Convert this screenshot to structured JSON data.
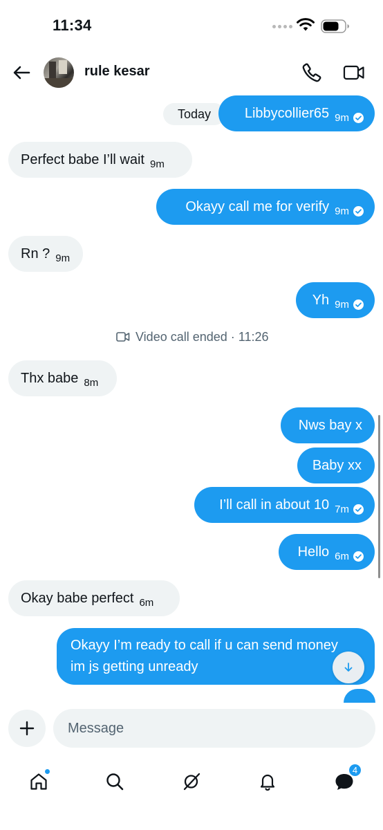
{
  "status_bar": {
    "time": "11:34"
  },
  "header": {
    "contact_name": "rule kesar"
  },
  "date_separator": "Today",
  "call_event": {
    "text": "Video call ended · 11:26"
  },
  "messages": [
    {
      "text": "Libbycollier65",
      "time": "9m",
      "direction": "out"
    },
    {
      "text": "Perfect babe I’ll wait",
      "time": "9m",
      "direction": "in"
    },
    {
      "text": "Okayy call me for verify",
      "time": "9m",
      "direction": "out"
    },
    {
      "text": "Rn ?",
      "time": "9m",
      "direction": "in"
    },
    {
      "text": "Yh",
      "time": "9m",
      "direction": "out"
    },
    {
      "text": "Thx babe",
      "time": "8m",
      "direction": "in"
    },
    {
      "text": "Nws bay x",
      "direction": "out"
    },
    {
      "text": "Baby xx",
      "direction": "out"
    },
    {
      "text": "I’ll call in about 10",
      "time": "7m",
      "direction": "out"
    },
    {
      "text": "Hello",
      "time": "6m",
      "direction": "out"
    },
    {
      "text": "Okay babe perfect",
      "time": "6m",
      "direction": "in"
    },
    {
      "text_line1": "Okayy I’m ready to call if u can send money",
      "text_line2": "im js getting unready",
      "direction": "out"
    }
  ],
  "composer": {
    "placeholder": "Message"
  },
  "bottom_nav": {
    "items": [
      {
        "icon": "home-icon",
        "has_dot": true
      },
      {
        "icon": "search-icon"
      },
      {
        "icon": "grok-icon"
      },
      {
        "icon": "bell-icon"
      },
      {
        "icon": "messages-icon",
        "badge": "4"
      }
    ]
  },
  "colors": {
    "accent": "#1d9bf0",
    "incoming_bubble": "#eff3f4",
    "text": "#0f1419",
    "muted": "#536471"
  }
}
